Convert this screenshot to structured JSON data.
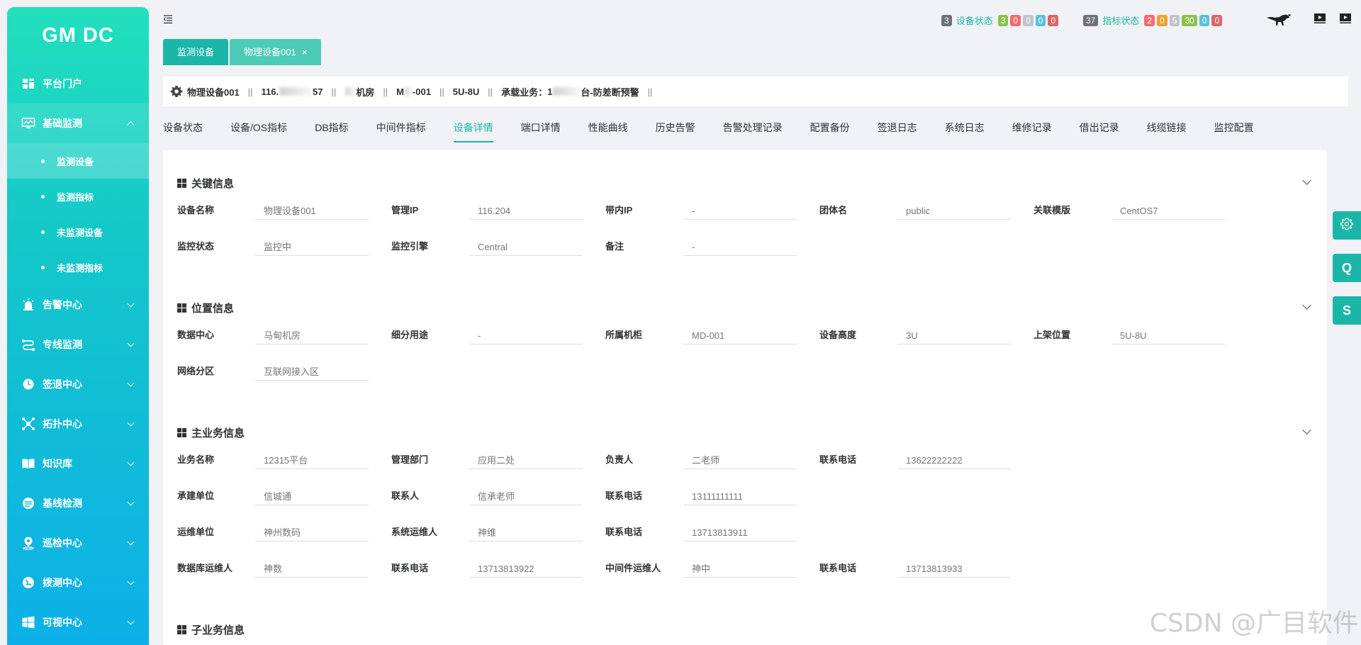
{
  "app": {
    "logo": "GM DC"
  },
  "sidebar": {
    "items": [
      {
        "label": "平台门户",
        "icon": "dashboard-icon"
      },
      {
        "label": "基础监测",
        "icon": "monitor-icon",
        "expanded": true,
        "active": true,
        "children": [
          {
            "label": "监测设备",
            "active": true
          },
          {
            "label": "监测指标"
          },
          {
            "label": "未监测设备"
          },
          {
            "label": "未监测指标"
          }
        ]
      },
      {
        "label": "告警中心",
        "icon": "alarm-icon"
      },
      {
        "label": "专线监测",
        "icon": "route-icon"
      },
      {
        "label": "签退中心",
        "icon": "clock-icon"
      },
      {
        "label": "拓扑中心",
        "icon": "topology-icon"
      },
      {
        "label": "知识库",
        "icon": "book-icon"
      },
      {
        "label": "基线检测",
        "icon": "baseline-icon"
      },
      {
        "label": "巡检中心",
        "icon": "location-icon"
      },
      {
        "label": "拨测中心",
        "icon": "dial-icon"
      },
      {
        "label": "可视中心",
        "icon": "windows-icon"
      }
    ]
  },
  "header": {
    "device_status": {
      "count": "3",
      "label": "设备状态",
      "badges": [
        {
          "value": "3",
          "color": "#8bc34a"
        },
        {
          "value": "0",
          "color": "#f56c6c"
        },
        {
          "value": "0",
          "color": "#c0c4cc"
        },
        {
          "value": "0",
          "color": "#5bc0de"
        },
        {
          "value": "0",
          "color": "#e06666"
        }
      ]
    },
    "metric_status": {
      "count": "37",
      "label": "指标状态",
      "badges": [
        {
          "value": "2",
          "color": "#f56c6c"
        },
        {
          "value": "0",
          "color": "#f0a030"
        },
        {
          "value": "5",
          "color": "#c0c4cc"
        },
        {
          "value": "30",
          "color": "#8bc34a"
        },
        {
          "value": "0",
          "color": "#5bc0de"
        },
        {
          "value": "0",
          "color": "#e06666"
        }
      ]
    }
  },
  "tabs": [
    {
      "label": "监测设备",
      "active": true
    },
    {
      "label": "物理设备001",
      "closable": true,
      "close_label": "×"
    }
  ],
  "info_bar": {
    "device": "物理设备001",
    "ip_prefix": "116.",
    "ip_suffix": "57",
    "room_suffix": "机房",
    "rack_prefix": "M",
    "rack_suffix": "-001",
    "position": "5U-8U",
    "business_label": "承载业务：",
    "business_prefix": "1",
    "business_suffix": "台-防差断预警",
    "separator": "||"
  },
  "subtabs": [
    "设备状态",
    "设备/OS指标",
    "DB指标",
    "中间件指标",
    "设备详情",
    "端口详情",
    "性能曲线",
    "历史告警",
    "告警处理记录",
    "配置备份",
    "签退日志",
    "系统日志",
    "维修记录",
    "借出记录",
    "线缆链接",
    "监控配置"
  ],
  "active_subtab": "设备详情",
  "sections": {
    "key_info": {
      "title": "关键信息",
      "rows": [
        [
          {
            "label": "设备名称",
            "value": "物理设备001"
          },
          {
            "label": "管理IP",
            "value": "116.204"
          },
          {
            "label": "带内IP",
            "value": "-"
          },
          {
            "label": "团体名",
            "value": "public"
          },
          {
            "label": "关联模版",
            "value": "CentOS7"
          }
        ],
        [
          {
            "label": "监控状态",
            "value": "监控中"
          },
          {
            "label": "监控引擎",
            "value": "Central"
          },
          {
            "label": "备注",
            "value": "-"
          }
        ]
      ]
    },
    "location_info": {
      "title": "位置信息",
      "rows": [
        [
          {
            "label": "数据中心",
            "value": "马甸机房"
          },
          {
            "label": "细分用途",
            "value": "-"
          },
          {
            "label": "所属机柜",
            "value": "MD-001"
          },
          {
            "label": "设备高度",
            "value": "3U"
          },
          {
            "label": "上架位置",
            "value": "5U-8U"
          }
        ],
        [
          {
            "label": "网络分区",
            "value": "互联网接入区"
          }
        ]
      ]
    },
    "main_business": {
      "title": "主业务信息",
      "rows": [
        [
          {
            "label": "业务名称",
            "value": "12315平台"
          },
          {
            "label": "管理部门",
            "value": "应用二处"
          },
          {
            "label": "负责人",
            "value": "二老师"
          },
          {
            "label": "联系电话",
            "value": "13622222222"
          }
        ],
        [
          {
            "label": "承建单位",
            "value": "信城通"
          },
          {
            "label": "联系人",
            "value": "信承老师"
          },
          {
            "label": "联系电话",
            "value": "13111111111"
          }
        ],
        [
          {
            "label": "运维单位",
            "value": "神州数码"
          },
          {
            "label": "系统运维人",
            "value": "神维"
          },
          {
            "label": "联系电话",
            "value": "13713813911"
          }
        ],
        [
          {
            "label": "数据库运维人",
            "value": "神数"
          },
          {
            "label": "联系电话",
            "value": "13713813922"
          },
          {
            "label": "中间件运维人",
            "value": "神中"
          },
          {
            "label": "联系电话",
            "value": "13713813933"
          }
        ]
      ]
    },
    "sub_business": {
      "title": "子业务信息"
    }
  },
  "float_buttons": [
    {
      "label": "",
      "icon": "settings-icon"
    },
    {
      "label": "Q"
    },
    {
      "label": "S"
    }
  ],
  "watermark": "CSDN @广目软件",
  "colors": {
    "accent": "#1bb6a8",
    "tab_active": "#1bb6a8",
    "tab_inactive": "#4dcab8"
  }
}
